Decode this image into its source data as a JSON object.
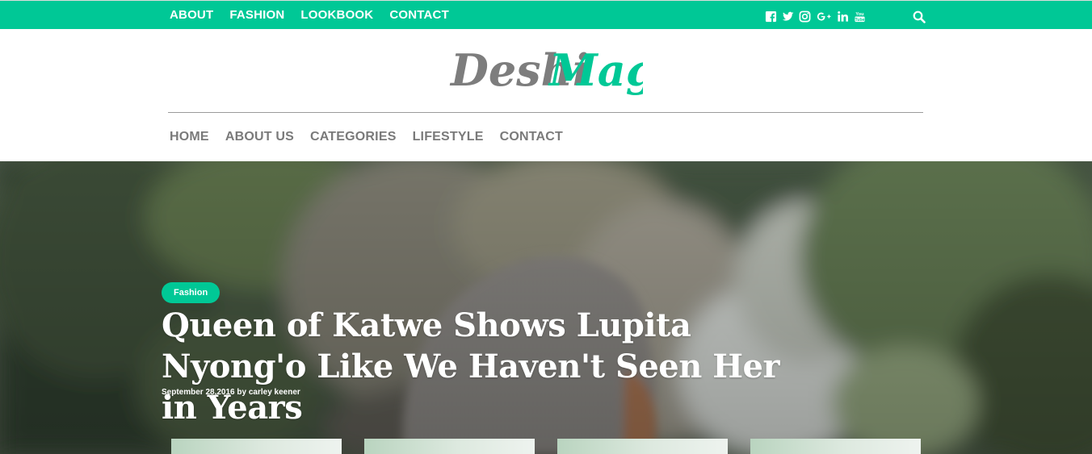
{
  "top_nav": [
    "ABOUT",
    "FASHION",
    "LOOKBOOK",
    "CONTACT"
  ],
  "social_icons": [
    "facebook-icon",
    "twitter-icon",
    "instagram-icon",
    "google-plus-icon",
    "linkedin-icon",
    "youtube-icon"
  ],
  "logo": {
    "part1": "Deshi",
    "part2": "Mag"
  },
  "main_nav": [
    "HOME",
    "ABOUT US",
    "CATEGORIES",
    "LIFESTYLE",
    "CONTACT"
  ],
  "hero": {
    "category": "Fashion",
    "title": "Queen of Katwe Shows Lupita Nyong'o Like We Haven't Seen Her in Years",
    "meta": "September 28,2016 by carley keener"
  },
  "colors": {
    "accent": "#00c896",
    "nav_text": "#7a7a7a",
    "logo_gray": "#7d7d7d"
  }
}
